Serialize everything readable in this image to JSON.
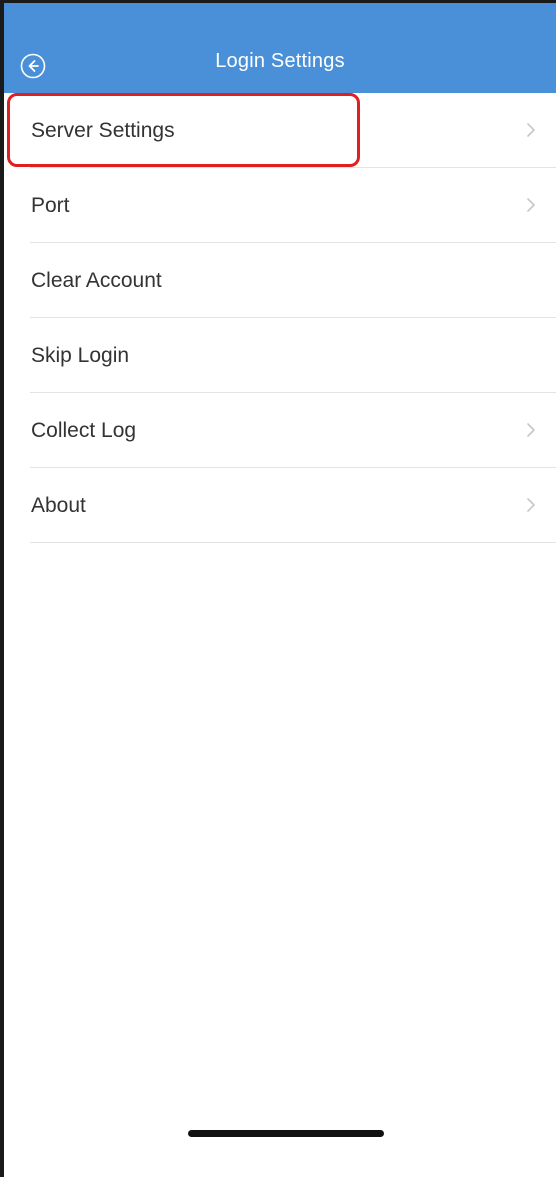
{
  "header": {
    "title": "Login Settings",
    "back_icon": "arrow-left-circle-icon",
    "background_color": "#4a90d9"
  },
  "menu": {
    "items": [
      {
        "label": "Server Settings",
        "has_chevron": true,
        "highlighted": true
      },
      {
        "label": "Port",
        "has_chevron": true
      },
      {
        "label": "Clear Account",
        "has_chevron": false
      },
      {
        "label": "Skip Login",
        "has_chevron": false
      },
      {
        "label": "Collect Log",
        "has_chevron": true
      },
      {
        "label": "About",
        "has_chevron": true
      }
    ],
    "chevron_icon": "chevron-right-icon"
  },
  "annotation": {
    "highlight_color": "#e02020"
  }
}
